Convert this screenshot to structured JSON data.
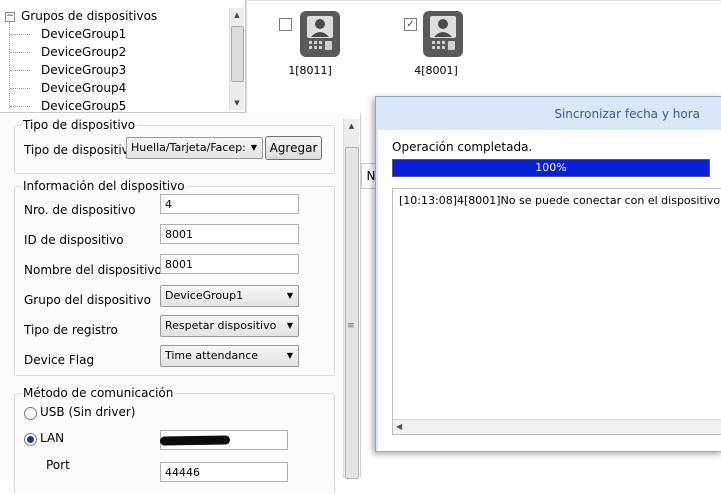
{
  "tree": {
    "root_label": "Grupos de dispositivos",
    "groups": [
      "DeviceGroup1",
      "DeviceGroup2",
      "DeviceGroup3",
      "DeviceGroup4",
      "DeviceGroup5"
    ]
  },
  "devices": [
    {
      "label": "1[8011]",
      "checked": false,
      "icon": "face-terminal-icon"
    },
    {
      "label": "4[8001]",
      "checked": true,
      "icon": "face-terminal-icon"
    }
  ],
  "form": {
    "device_type_group": {
      "legend": "Tipo de dispositivo",
      "type_label": "Tipo de dispositivo",
      "type_value": "Huella/Tarjeta/Facep:",
      "add_button": "Agregar"
    },
    "device_info": {
      "legend": "Información del dispositivo",
      "number_label": "Nro. de dispositivo",
      "number_value": "4",
      "id_label": "ID de dispositivo",
      "id_value": "8001",
      "name_label": "Nombre del dispositivo",
      "name_value": "8001",
      "group_label": "Grupo del dispositivo",
      "group_value": "DeviceGroup1",
      "register_label": "Tipo de registro",
      "register_value": "Respetar dispositivo",
      "flag_label": "Device Flag",
      "flag_value": "Time attendance"
    },
    "comm": {
      "legend": "Método de comunicación",
      "usb_label": "USB (Sin driver)",
      "lan_label": "LAN",
      "selected": "LAN",
      "port_label": "Port",
      "port_value": "44446"
    }
  },
  "behind_tab": "N",
  "dialog": {
    "title": "Sincronizar fecha y hora",
    "status": "Operación completada.",
    "progress_percent": 100,
    "progress_text": "100%",
    "progress_color": "#0a1fd8",
    "log": [
      "[10:13:08]4[8001]No se puede conectar con el dispositivo"
    ]
  }
}
